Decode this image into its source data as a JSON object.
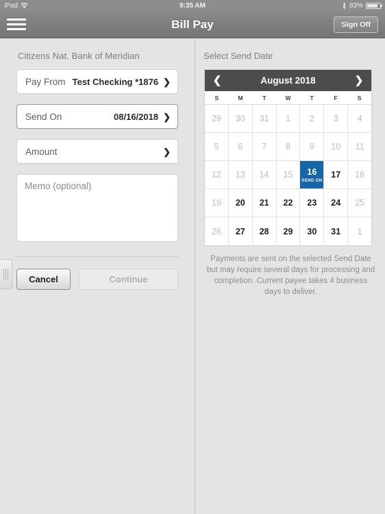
{
  "status_bar": {
    "device": "iPad",
    "wifi_icon": "wifi-icon",
    "time": "9:35 AM",
    "bluetooth_icon": "bluetooth-icon",
    "battery_percent": "83%",
    "battery_level": 83
  },
  "nav": {
    "menu_icon": "hamburger-menu-icon",
    "title": "Bill Pay",
    "sign_off_label": "Sign Off"
  },
  "left_panel": {
    "bank_name": "Citizens Nat. Bank of Meridian",
    "fields": [
      {
        "label": "Pay From",
        "value": "Test Checking *1876",
        "active": false
      },
      {
        "label": "Send On",
        "value": "08/16/2018",
        "active": true
      },
      {
        "label": "Amount",
        "value": "",
        "active": false
      }
    ],
    "memo_placeholder": "Memo (optional)",
    "chevron_icon": "chevron-right-icon",
    "drag_handle_icon": "drag-handle-icon",
    "buttons": {
      "cancel_label": "Cancel",
      "continue_label": "Continue",
      "continue_disabled": true
    }
  },
  "right_panel": {
    "title": "Select Send Date",
    "calendar": {
      "prev_icon": "chevron-left-icon",
      "next_icon": "chevron-right-icon",
      "month_label": "August 2018",
      "weekday_headers": [
        "S",
        "M",
        "T",
        "W",
        "T",
        "F",
        "S"
      ],
      "selected_day": 16,
      "selected_tag": "SEND ON",
      "weeks": [
        [
          {
            "day": "29",
            "dim": true
          },
          {
            "day": "30",
            "dim": true
          },
          {
            "day": "31",
            "dim": true
          },
          {
            "day": "1",
            "dim": true
          },
          {
            "day": "2",
            "dim": true
          },
          {
            "day": "3",
            "dim": true
          },
          {
            "day": "4",
            "dim": true
          }
        ],
        [
          {
            "day": "5",
            "dim": true
          },
          {
            "day": "6",
            "dim": true
          },
          {
            "day": "7",
            "dim": true
          },
          {
            "day": "8",
            "dim": true
          },
          {
            "day": "9",
            "dim": true
          },
          {
            "day": "10",
            "dim": true
          },
          {
            "day": "11",
            "dim": true
          }
        ],
        [
          {
            "day": "12",
            "dim": true
          },
          {
            "day": "13",
            "dim": true
          },
          {
            "day": "14",
            "dim": true
          },
          {
            "day": "15",
            "dim": true
          },
          {
            "day": "16",
            "dim": false,
            "selected": true,
            "tag": "SEND ON"
          },
          {
            "day": "17",
            "dim": false
          },
          {
            "day": "18",
            "dim": true
          }
        ],
        [
          {
            "day": "19",
            "dim": true
          },
          {
            "day": "20",
            "dim": false
          },
          {
            "day": "21",
            "dim": false
          },
          {
            "day": "22",
            "dim": false
          },
          {
            "day": "23",
            "dim": false
          },
          {
            "day": "24",
            "dim": false
          },
          {
            "day": "25",
            "dim": true
          }
        ],
        [
          {
            "day": "26",
            "dim": true
          },
          {
            "day": "27",
            "dim": false
          },
          {
            "day": "28",
            "dim": false
          },
          {
            "day": "29",
            "dim": false
          },
          {
            "day": "30",
            "dim": false
          },
          {
            "day": "31",
            "dim": false
          },
          {
            "day": "1",
            "dim": true
          }
        ]
      ]
    },
    "note": "Payments are sent on the selected Send Date but may require several days for processing and completion. Current payee takes 4 business days to deliver."
  },
  "colors": {
    "accent_blue": "#1565a8",
    "calendar_header": "#4c4c4c",
    "nav_bar": "#7e7e7e",
    "page_background": "#e4e4e4"
  }
}
